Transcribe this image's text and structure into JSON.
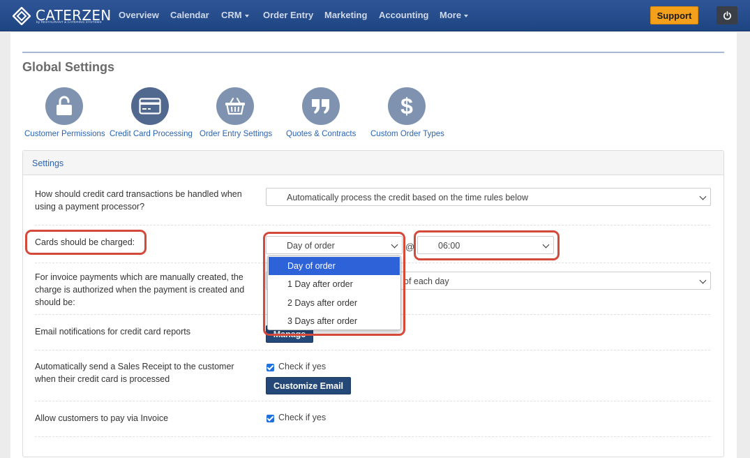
{
  "nav": {
    "logo_text": "CATERZEN",
    "logo_sub": "by RESTAURANT & CATERING SYSTEMS",
    "items": [
      {
        "label": "Overview"
      },
      {
        "label": "Calendar"
      },
      {
        "label": "CRM"
      },
      {
        "label": "Order Entry"
      },
      {
        "label": "Marketing"
      },
      {
        "label": "Accounting"
      },
      {
        "label": "More"
      }
    ],
    "support_label": "Support",
    "power_icon": "power-icon"
  },
  "page": {
    "title": "Global Settings"
  },
  "settings_icons": [
    {
      "label": "Customer Permissions",
      "icon": "unlock-icon"
    },
    {
      "label": "Credit Card Processing",
      "icon": "credit-card-icon"
    },
    {
      "label": "Order Entry Settings",
      "icon": "basket-icon"
    },
    {
      "label": "Quotes & Contracts",
      "icon": "quote-icon"
    },
    {
      "label": "Custom Order Types",
      "icon": "dollar-icon"
    }
  ],
  "panel": {
    "title": "Settings",
    "rows": {
      "transactions": {
        "label": "How should credit card transactions be handled when using a payment processor?",
        "value": "Automatically process the credit based on the time rules below"
      },
      "charged": {
        "label": "Cards should be charged:",
        "day_value": "Day of order",
        "at_symbol": "@",
        "time_value": "06:00",
        "options": [
          "Day of order",
          "1 Day after order",
          "2 Days after order",
          "3 Days after order"
        ]
      },
      "invoice_payments": {
        "label": "For invoice payments which are manually created, the charge is authorized when the payment is created and should be:",
        "value_partial": "of each day"
      },
      "email_notifications": {
        "label": "Email notifications for credit card reports",
        "button_label": "Manage"
      },
      "sales_receipt": {
        "label": "Automatically send a Sales Receipt to the customer when their credit card is processed",
        "check_label": "Check if yes",
        "button_label": "Customize Email"
      },
      "pay_via_invoice": {
        "label": "Allow customers to pay via Invoice",
        "check_label": "Check if yes"
      }
    }
  },
  "colors": {
    "nav_bg": "#2f5597",
    "accent_link": "#2b63b4",
    "support": "#f5a01a",
    "dark_button": "#244877",
    "highlight_ring": "#d5493a",
    "selected_option": "#2e62d9"
  }
}
